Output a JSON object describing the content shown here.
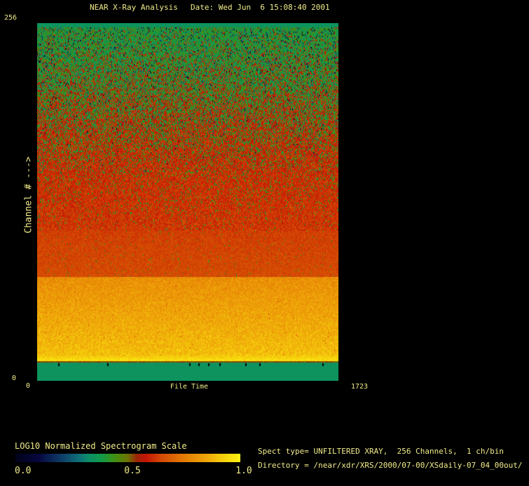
{
  "window": {
    "background": "#000000",
    "text_color": "#F1EC89"
  },
  "header": {
    "title": "NEAR X-Ray Analysis",
    "date_label": "Date: Wed Jun  6 15:08:40 2001"
  },
  "axes": {
    "y_label": "Channel # --->",
    "y_max": "256",
    "y_min": "0",
    "x_label": "File Time",
    "x_min": "0",
    "x_max": "1723"
  },
  "scale_bar": {
    "title": "LOG10 Normalized Spectrogram Scale",
    "tick_left": "0.0",
    "tick_mid": "0.5",
    "tick_right": "1.0"
  },
  "info": {
    "spect_line": "Spect type= UNFILTERED XRAY,  256 Channels,  1 ch/bin",
    "directory_line": "Directory = /near/xdr/XRS/2000/07-00/XSdaily-07_04_00out/"
  },
  "chart_data": {
    "type": "heatmap",
    "title": "NEAR X-Ray Analysis",
    "xlabel": "File Time",
    "ylabel": "Channel # --->",
    "xlim": [
      0,
      1723
    ],
    "ylim": [
      0,
      256
    ],
    "x_tick_labels": [
      "0",
      "1723"
    ],
    "y_tick_labels": [
      "0",
      "256"
    ],
    "grid": false,
    "legend_position": "none",
    "colorbar": {
      "title": "LOG10 Normalized Spectrogram Scale",
      "range": [
        0.0,
        1.0
      ],
      "tick_labels": [
        "0.0",
        "0.5",
        "1.0"
      ]
    },
    "colormap": [
      [
        0.0,
        "#02021a"
      ],
      [
        0.1,
        "#06063e"
      ],
      [
        0.2,
        "#0e3a66"
      ],
      [
        0.28,
        "#0f6e78"
      ],
      [
        0.33,
        "#0d9066"
      ],
      [
        0.38,
        "#109a4a"
      ],
      [
        0.44,
        "#3f9112"
      ],
      [
        0.5,
        "#6e7404"
      ],
      [
        0.54,
        "#9c2406"
      ],
      [
        0.58,
        "#c41505"
      ],
      [
        0.65,
        "#d44a03"
      ],
      [
        0.75,
        "#e57c05"
      ],
      [
        0.85,
        "#efa609"
      ],
      [
        0.95,
        "#f8dd0e"
      ],
      [
        1.0,
        "#fcf214"
      ]
    ],
    "value_profile_bands": [
      {
        "type": "solid",
        "y0": 0.0,
        "y1": 0.009,
        "value": 0.345
      },
      {
        "type": "duotone",
        "y0": 0.009,
        "y1": 0.18,
        "p0": 0.05,
        "p1": 0.38,
        "green_mu": 0.4,
        "green_sig": 0.05,
        "red_mu0": 0.575,
        "red_mu1": 0.585,
        "red_sig": 0.035,
        "dark_p0": 0.1,
        "dark_p1": 0.05,
        "dark_mu": 0.17,
        "dark_sig": 0.1
      },
      {
        "type": "duotone",
        "y0": 0.18,
        "y1": 0.3,
        "p0": 0.38,
        "p1": 0.62,
        "green_mu": 0.41,
        "green_sig": 0.05,
        "red_mu0": 0.585,
        "red_mu1": 0.595,
        "red_sig": 0.035,
        "dark_p0": 0.05,
        "dark_p1": 0.02,
        "dark_mu": 0.18,
        "dark_sig": 0.1
      },
      {
        "type": "duotone",
        "y0": 0.3,
        "y1": 0.42,
        "p0": 0.62,
        "p1": 0.85,
        "green_mu": 0.42,
        "green_sig": 0.05,
        "red_mu0": 0.595,
        "red_mu1": 0.61,
        "red_sig": 0.035,
        "dark_p0": 0.02,
        "dark_p1": 0.005,
        "dark_mu": 0.2,
        "dark_sig": 0.1
      },
      {
        "type": "duotone",
        "y0": 0.42,
        "y1": 0.58,
        "p0": 0.85,
        "p1": 0.97,
        "green_mu": 0.43,
        "green_sig": 0.04,
        "red_mu0": 0.61,
        "red_mu1": 0.625,
        "red_sig": 0.03,
        "dark_p0": 0.0,
        "dark_p1": 0.0,
        "dark_mu": 0.2,
        "dark_sig": 0.1
      },
      {
        "type": "noise",
        "y0": 0.58,
        "y1": 0.71,
        "base0": 0.635,
        "base1": 0.655,
        "amp": 0.028,
        "speck_p": 0.02,
        "speck_mu": 0.46,
        "speck_sig": 0.03
      },
      {
        "type": "noise",
        "y0": 0.71,
        "y1": 0.93,
        "base0": 0.795,
        "base1": 0.895,
        "amp": 0.05,
        "speck_p": 0.004,
        "speck_mu": 0.7,
        "speck_sig": 0.02
      },
      {
        "type": "noise",
        "y0": 0.93,
        "y1": 0.947,
        "base0": 0.9,
        "base1": 0.97,
        "amp": 0.03,
        "speck_p": 0,
        "speck_mu": 0,
        "speck_sig": 0
      },
      {
        "type": "noise",
        "y0": 0.947,
        "y1": 0.951,
        "base0": 0.52,
        "base1": 0.52,
        "amp": 0.02,
        "speck_p": 0,
        "speck_mu": 0,
        "speck_sig": 0
      },
      {
        "type": "solid",
        "y0": 0.951,
        "y1": 1.0,
        "value": 0.345
      }
    ],
    "bottom_gap_tick_x_fracs": [
      0.07,
      0.233,
      0.505,
      0.535,
      0.567,
      0.605,
      0.691,
      0.737,
      0.947
    ],
    "bottom_gap_tick_y_frac": 0.951
  }
}
